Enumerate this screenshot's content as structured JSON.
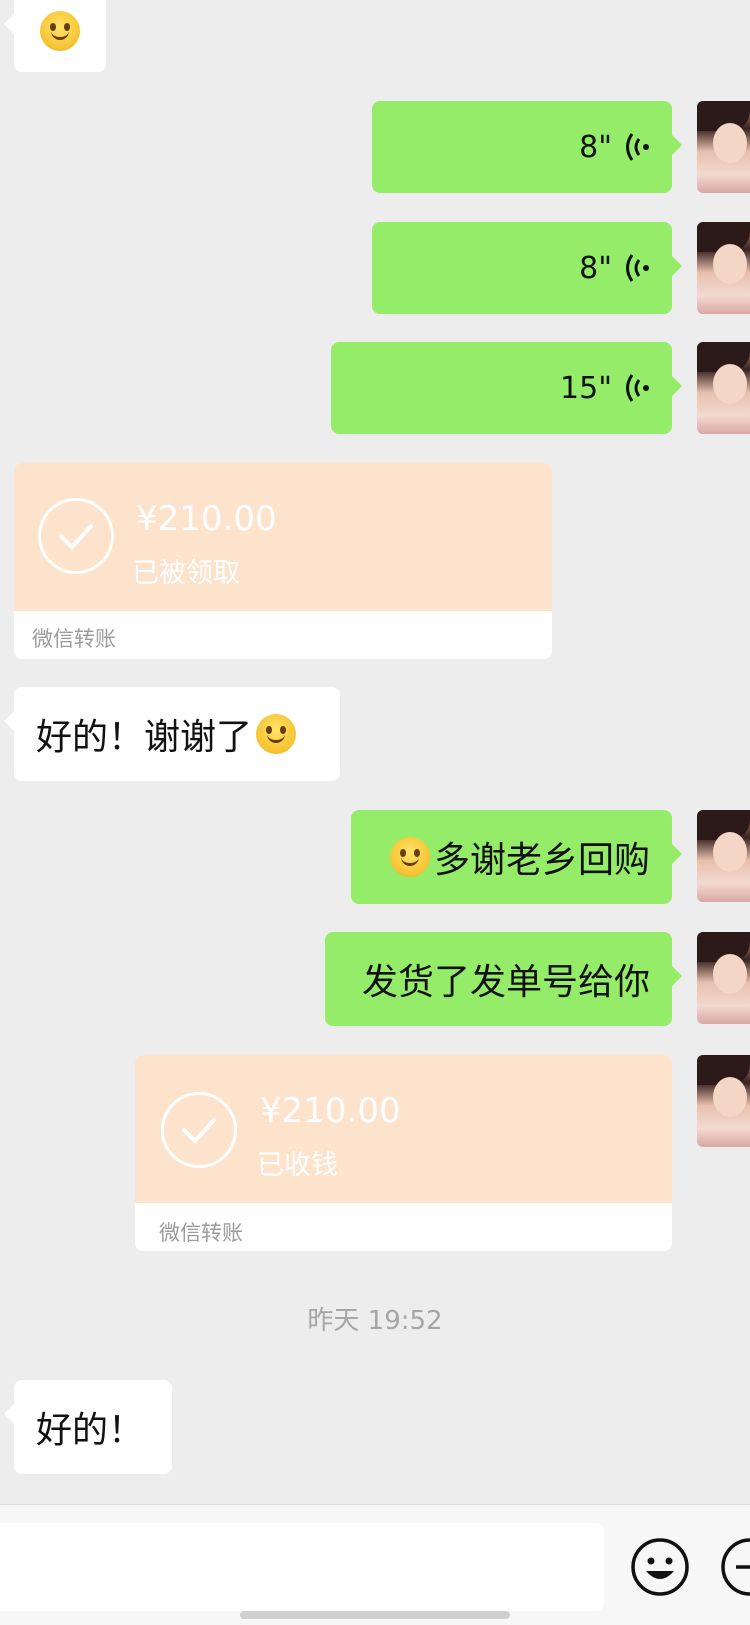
{
  "messages": {
    "voice1": {
      "duration": "8\""
    },
    "voice2": {
      "duration": "8\""
    },
    "voice3": {
      "duration": "15\""
    },
    "transfer1": {
      "amount": "¥210.00",
      "status": "已被领取",
      "label": "微信转账"
    },
    "left_text1": {
      "text": "好的！谢谢了"
    },
    "right_text1": {
      "text": "多谢老乡回购"
    },
    "right_text2": {
      "text": "发货了发单号给你"
    },
    "transfer2": {
      "amount": "¥210.00",
      "status": "已收钱",
      "label": "微信转账"
    },
    "timestamp": {
      "text": "昨天 19:52"
    },
    "left_text2": {
      "text": "好的！"
    }
  },
  "icons": {
    "voice": "voice-wave-icon",
    "check": "check-circle-icon",
    "emoji": "smile-emoji-icon",
    "add": "plus-circle-icon"
  },
  "colors": {
    "background": "#ededed",
    "outgoing_bubble": "#95ec69",
    "incoming_bubble": "#ffffff",
    "transfer_bg": "#fde3cc"
  }
}
